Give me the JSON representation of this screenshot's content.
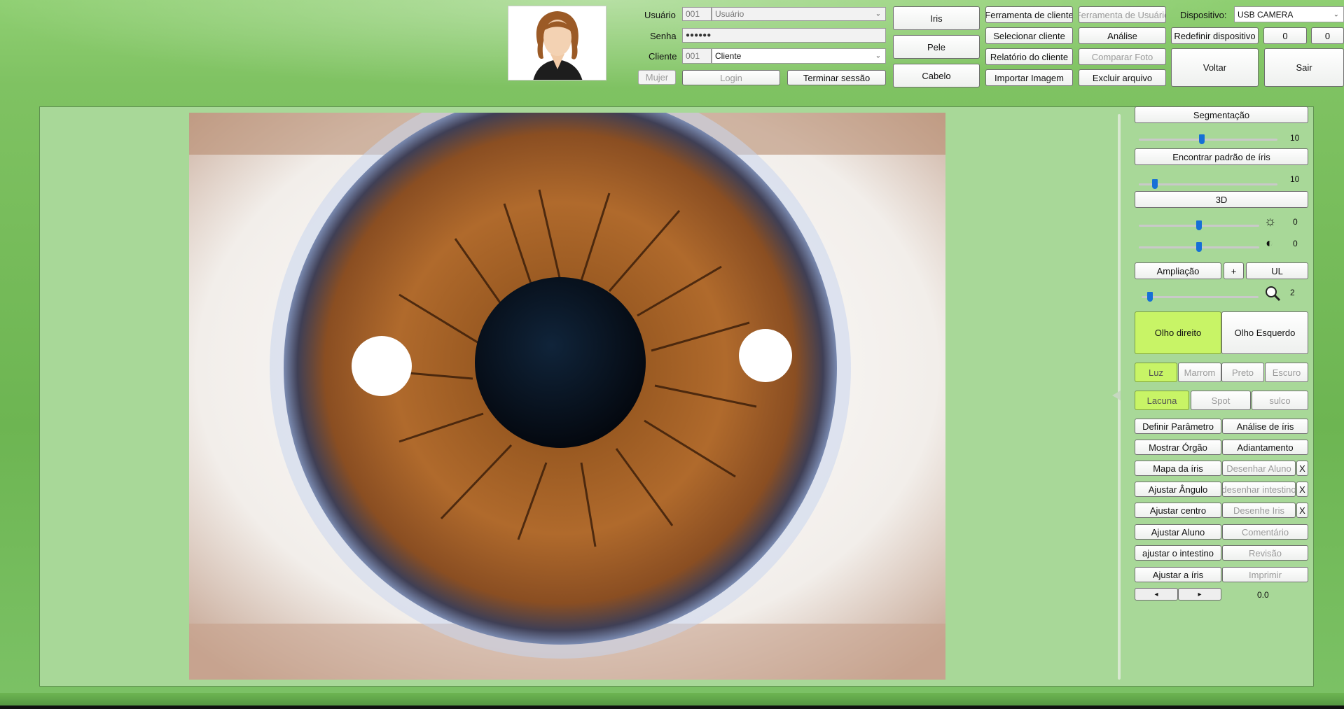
{
  "header": {
    "usuario_label": "Usuário",
    "usuario_code": "001",
    "usuario_placeholder": "Usuário",
    "senha_label": "Senha",
    "senha_value": "●●●●●●",
    "cliente_label": "Cliente",
    "cliente_code": "001",
    "cliente_value": "Cliente",
    "gender_label": "Mujer",
    "login_label": "Login",
    "terminar_label": "Terminar sessão",
    "iris_label": "Iris",
    "pele_label": "Pele",
    "cabelo_label": "Cabelo",
    "ferramenta_cliente": "Ferramenta de cliente",
    "ferramenta_usuario": "Ferramenta de Usuário",
    "selecionar_cliente": "Selecionar cliente",
    "analise": "Análise",
    "relatorio_cliente": "Relatório do cliente",
    "comparar_foto": "Comparar Foto",
    "importar_imagem": "Importar Imagem",
    "excluir_arquivo": "Excluir arquivo",
    "dispositivo_label": "Dispositivo:",
    "dispositivo_value": "USB CAMERA",
    "redefinir_dispositivo": "Redefinir dispositivo",
    "counter_a": "0",
    "counter_b": "0",
    "voltar": "Voltar",
    "sair": "Sair"
  },
  "panel": {
    "segmentacao": "Segmentação",
    "segmentacao_value": "10",
    "encontrar_padrao": "Encontrar padrão de íris",
    "encontrar_value": "10",
    "three_d": "3D",
    "brightness_value": "0",
    "contrast_value": "0",
    "ampliacao": "Ampliação",
    "plus": "+",
    "ul": "UL",
    "zoom_value": "2",
    "olho_direito": "Olho direito",
    "olho_esquerdo": "Olho Esquerdo",
    "luz": "Luz",
    "marrom": "Marrom",
    "preto": "Preto",
    "escuro": "Escuro",
    "lacuna": "Lacuna",
    "spot": "Spot",
    "sulco": "sulco",
    "definir_parametro": "Definir Parâmetro",
    "analise_iris": "Análise de íris",
    "mostrar_orgao": "Mostrar Órgão",
    "adiantamento": "Adiantamento",
    "mapa_iris": "Mapa da íris",
    "desenhar_aluno": "Desenhar Aluno",
    "ajustar_angulo": "Ajustar Ângulo",
    "desenhar_intestino": "desenhar intestino",
    "ajustar_centro": "Ajustar centro",
    "desenhe_iris": "Desenhe Iris",
    "ajustar_aluno": "Ajustar Aluno",
    "comentario": "Comentário",
    "ajustar_intestino": "ajustar o intestino",
    "revisao": "Revisão",
    "ajustar_iris": "Ajustar a íris",
    "imprimir": "Imprimir",
    "close_x": "X",
    "prev_arrow": "◂",
    "next_arrow": "▸",
    "angle_value": "0.0"
  },
  "levels": {
    "segmentacao": 0.45,
    "encontrar": 0.1,
    "brightness": 0.5,
    "contrast": 0.5,
    "zoom": 0.05
  },
  "colors": {
    "active_green": "#c8f466",
    "slider_thumb": "#1670d6",
    "viewport_bg": "#a8d898"
  }
}
